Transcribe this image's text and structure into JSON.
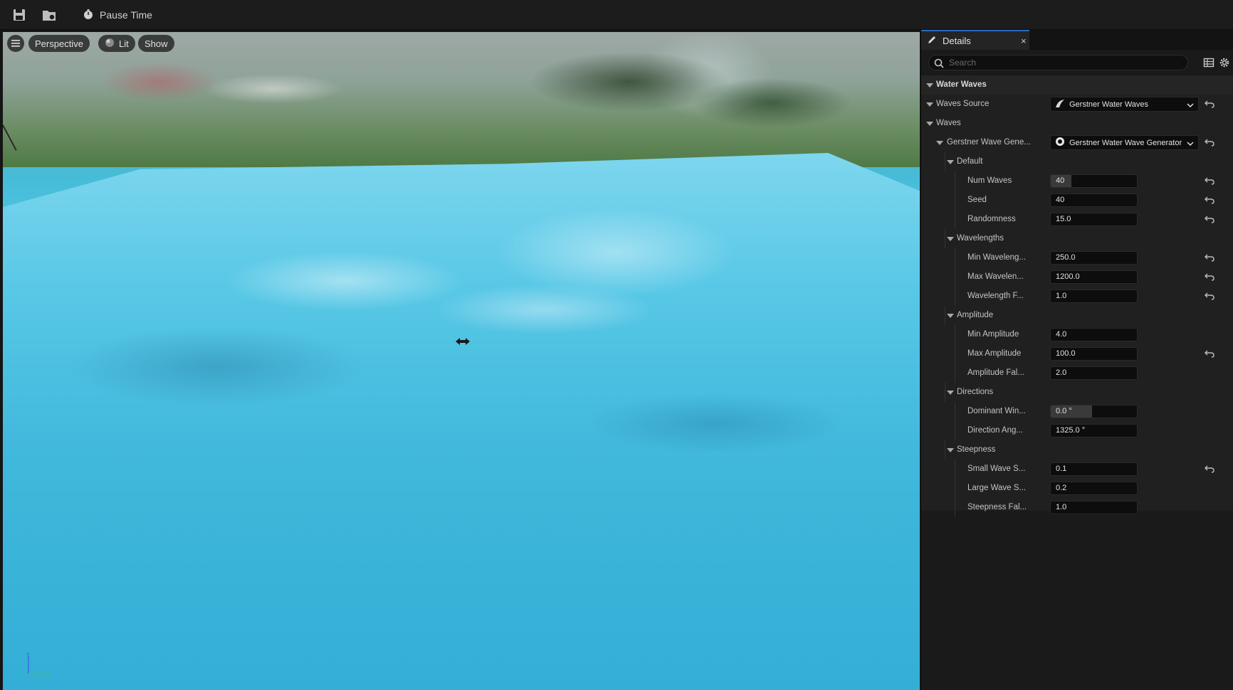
{
  "toolbar": {
    "save_icon": "save-icon",
    "browse_icon": "content-browser-icon",
    "pause_icon": "stopwatch-icon",
    "pause_label": "Pause Time"
  },
  "viewport": {
    "menu_icon": "hamburger-icon",
    "perspective_label": "Perspective",
    "lit_label": "Lit",
    "show_label": "Show",
    "axis_labels": {
      "z": "z",
      "x": "x"
    }
  },
  "details": {
    "tab_label": "Details",
    "close_symbol": "×",
    "search_placeholder": "Search",
    "rows": [
      {
        "label": "Water Waves",
        "kind": "category",
        "depth": 0
      },
      {
        "label": "Waves Source",
        "kind": "dropdown",
        "depth": 0,
        "value": "Gerstner Water Waves",
        "icon": "wave-asset-icon",
        "reset": true
      },
      {
        "label": "Waves",
        "kind": "group",
        "depth": 1
      },
      {
        "label": "Gerstner Wave Gene...",
        "kind": "dropdown",
        "depth": 2,
        "value": "Gerstner Water Wave Generator",
        "icon": "generator-icon",
        "reset": true
      },
      {
        "label": "Default",
        "kind": "group",
        "depth": 3
      },
      {
        "label": "Num Waves",
        "kind": "field",
        "depth": 4,
        "value": "40",
        "fill": 0.24,
        "reset": true
      },
      {
        "label": "Seed",
        "kind": "field",
        "depth": 4,
        "value": "40",
        "reset": true
      },
      {
        "label": "Randomness",
        "kind": "field",
        "depth": 4,
        "value": "15.0",
        "reset": true
      },
      {
        "label": "Wavelengths",
        "kind": "group",
        "depth": 3
      },
      {
        "label": "Min Waveleng...",
        "kind": "field",
        "depth": 4,
        "value": "250.0",
        "reset": true
      },
      {
        "label": "Max Wavelen...",
        "kind": "field",
        "depth": 4,
        "value": "1200.0",
        "reset": true
      },
      {
        "label": "Wavelength F...",
        "kind": "field",
        "depth": 4,
        "value": "1.0",
        "reset": true
      },
      {
        "label": "Amplitude",
        "kind": "group",
        "depth": 3
      },
      {
        "label": "Min Amplitude",
        "kind": "field",
        "depth": 4,
        "value": "4.0",
        "reset": false
      },
      {
        "label": "Max Amplitude",
        "kind": "field",
        "depth": 4,
        "value": "100.0",
        "reset": true
      },
      {
        "label": "Amplitude Fal...",
        "kind": "field",
        "depth": 4,
        "value": "2.0",
        "reset": false
      },
      {
        "label": "Directions",
        "kind": "group",
        "depth": 3
      },
      {
        "label": "Dominant Win...",
        "kind": "field",
        "depth": 4,
        "value": "0.0 °",
        "fill": 0.48,
        "reset": false
      },
      {
        "label": "Direction Ang...",
        "kind": "field",
        "depth": 4,
        "value": "1325.0 °",
        "reset": false
      },
      {
        "label": "Steepness",
        "kind": "group",
        "depth": 3
      },
      {
        "label": "Small Wave S...",
        "kind": "field",
        "depth": 4,
        "value": "0.1",
        "reset": true
      },
      {
        "label": "Large Wave S...",
        "kind": "field",
        "depth": 4,
        "value": "0.2",
        "reset": false
      },
      {
        "label": "Steepness Fal...",
        "kind": "field",
        "depth": 4,
        "value": "1.0",
        "reset": false
      }
    ]
  },
  "colors": {
    "accent": "#2d6cc0",
    "panel_bg": "#1a1a1a",
    "water": "#36b3d7"
  }
}
